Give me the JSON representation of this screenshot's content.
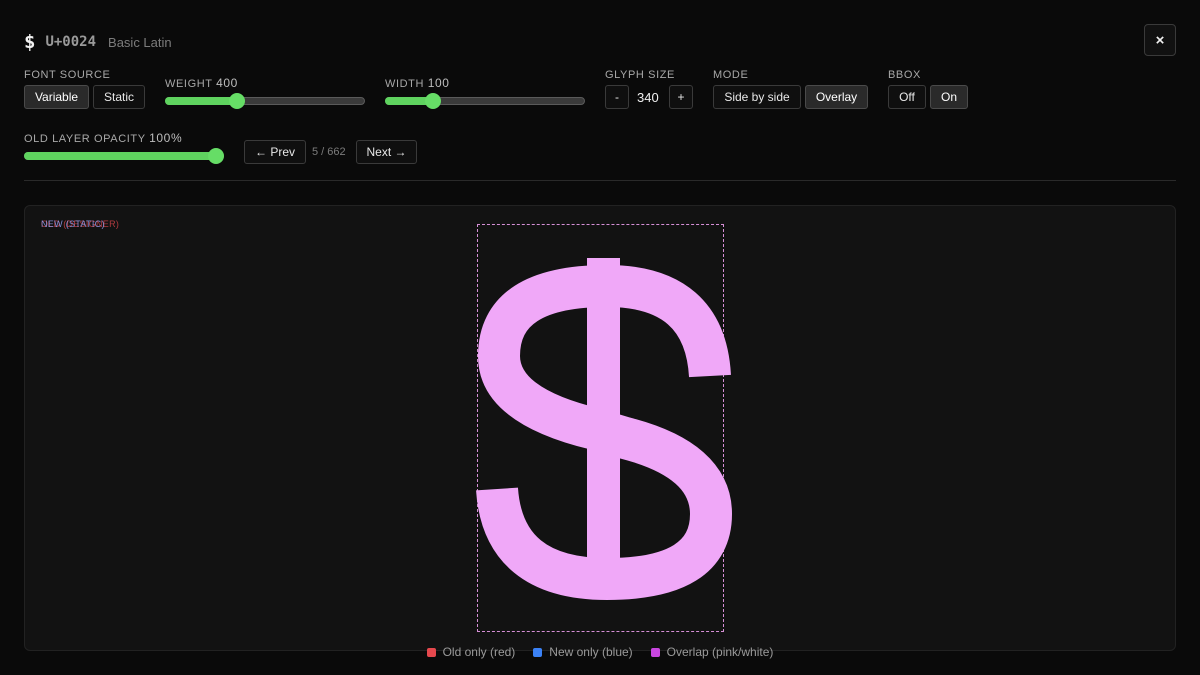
{
  "header": {
    "glyph": "$",
    "codepoint": "U+0024",
    "block": "Basic Latin",
    "close": "×"
  },
  "controls": {
    "font_source": {
      "label": "FONT SOURCE",
      "options": [
        "Variable",
        "Static"
      ],
      "selected": "Variable"
    },
    "weight": {
      "label": "WEIGHT",
      "value": "400",
      "fraction": 0.35
    },
    "width": {
      "label": "WIDTH",
      "value": "100",
      "fraction": 0.22
    },
    "glyph_size": {
      "label": "GLYPH SIZE",
      "minus": "-",
      "value": "340",
      "plus": "+"
    },
    "mode": {
      "label": "MODE",
      "options": [
        "Side by side",
        "Overlay"
      ],
      "selected": "Overlay"
    },
    "bbox": {
      "label": "BBOX",
      "options": [
        "Off",
        "On"
      ],
      "selected": "On"
    },
    "old_layer_opacity": {
      "label": "OLD LAYER OPACITY",
      "value": "100%",
      "fraction": 1.0
    }
  },
  "nav": {
    "prev": "← Prev",
    "position": "5 / 662",
    "next": "Next →"
  },
  "canvas": {
    "old_label": "OLD (DESIGNER)",
    "new_label": "NEW (STATIC)"
  },
  "legend": [
    {
      "label": "Old only (red)",
      "color": "#e5484d"
    },
    {
      "label": "New only (blue)",
      "color": "#3b82f6"
    },
    {
      "label": "Overlap (pink/white)",
      "color": "#c946e0"
    }
  ],
  "colors": {
    "accent": "#66dd66",
    "overlap_fill": "#f0a8f8",
    "bbox_stroke": "#d68fd6"
  }
}
